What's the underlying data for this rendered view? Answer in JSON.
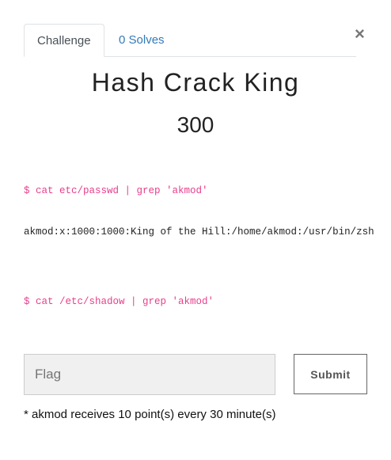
{
  "tabs": {
    "challenge": "Challenge",
    "solves": "0 Solves"
  },
  "close": "×",
  "challenge": {
    "name": "Hash Crack King",
    "value": "300"
  },
  "description": {
    "cmd1": "$ cat etc/passwd | grep 'akmod'",
    "out1": "akmod:x:1000:1000:King of the Hill:/home/akmod:/usr/bin/zsh",
    "cmd2": "$ cat /etc/shadow | grep 'akmod'"
  },
  "form": {
    "placeholder": "Flag",
    "value": "",
    "submit": "Submit"
  },
  "note": "* akmod receives 10 point(s) every 30 minute(s)"
}
